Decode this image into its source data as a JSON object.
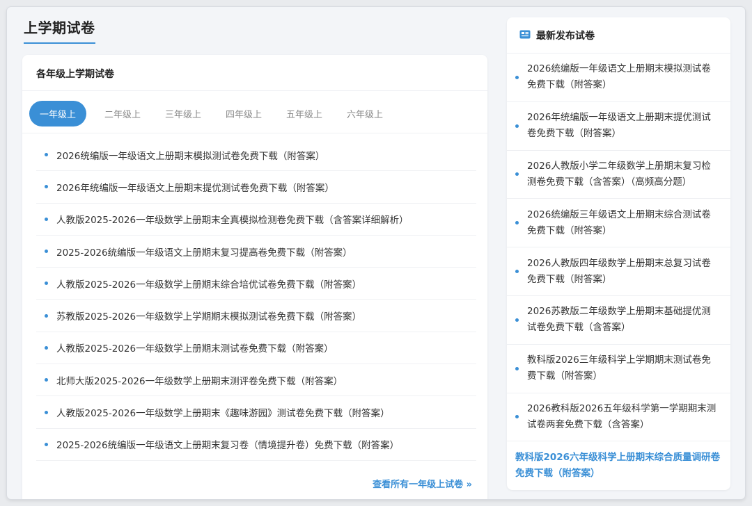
{
  "page": {
    "title": "上学期试卷"
  },
  "main": {
    "card_title": "各年级上学期试卷",
    "tabs": [
      {
        "label": "一年级上",
        "active": true
      },
      {
        "label": "二年级上",
        "active": false
      },
      {
        "label": "三年级上",
        "active": false
      },
      {
        "label": "四年级上",
        "active": false
      },
      {
        "label": "五年级上",
        "active": false
      },
      {
        "label": "六年级上",
        "active": false
      }
    ],
    "items": [
      "2026统编版一年级语文上册期末模拟测试卷免费下载（附答案）",
      "2026年统编版一年级语文上册期末提优测试卷免费下载（附答案）",
      "人教版2025-2026一年级数学上册期末全真模拟检测卷免费下载（含答案详细解析）",
      "2025-2026统编版一年级语文上册期末复习提高卷免费下载（附答案）",
      "人教版2025-2026一年级数学上册期末综合培优试卷免费下载（附答案）",
      "苏教版2025-2026一年级数学上学期期末模拟测试卷免费下载（附答案）",
      "人教版2025-2026一年级数学上册期末测试卷免费下载（附答案）",
      "北师大版2025-2026一年级数学上册期末测评卷免费下载（附答案）",
      "人教版2025-2026一年级数学上册期末《趣味游园》测试卷免费下载（附答案）",
      "2025-2026统编版一年级语文上册期末复习卷（情境提升卷）免费下载（附答案）"
    ],
    "more_link": "查看所有一年级上试卷 »"
  },
  "sidebar": {
    "title": "最新发布试卷",
    "icon": "newspaper-icon",
    "items": [
      "2026统编版一年级语文上册期末模拟测试卷免费下载（附答案）",
      "2026年统编版一年级语文上册期末提优测试卷免费下载（附答案）",
      "2026人教版小学二年级数学上册期末复习检测卷免费下载（含答案）（高频高分题）",
      "2026统编版三年级语文上册期末综合测试卷免费下载（附答案）",
      "2026人教版四年级数学上册期末总复习试卷免费下载（附答案）",
      "2026苏教版二年级数学上册期末基础提优测试卷免费下载（含答案）",
      "教科版2026三年级科学上学期期末测试卷免费下载（附答案）",
      "2026教科版2026五年级科学第一学期期末测试卷两套免费下载（含答案）"
    ],
    "highlight": "教科版2026六年级科学上册期末综合质量调研卷免费下载（附答案）"
  },
  "colors": {
    "accent": "#3a8fd6",
    "background": "#f3f5f8"
  }
}
